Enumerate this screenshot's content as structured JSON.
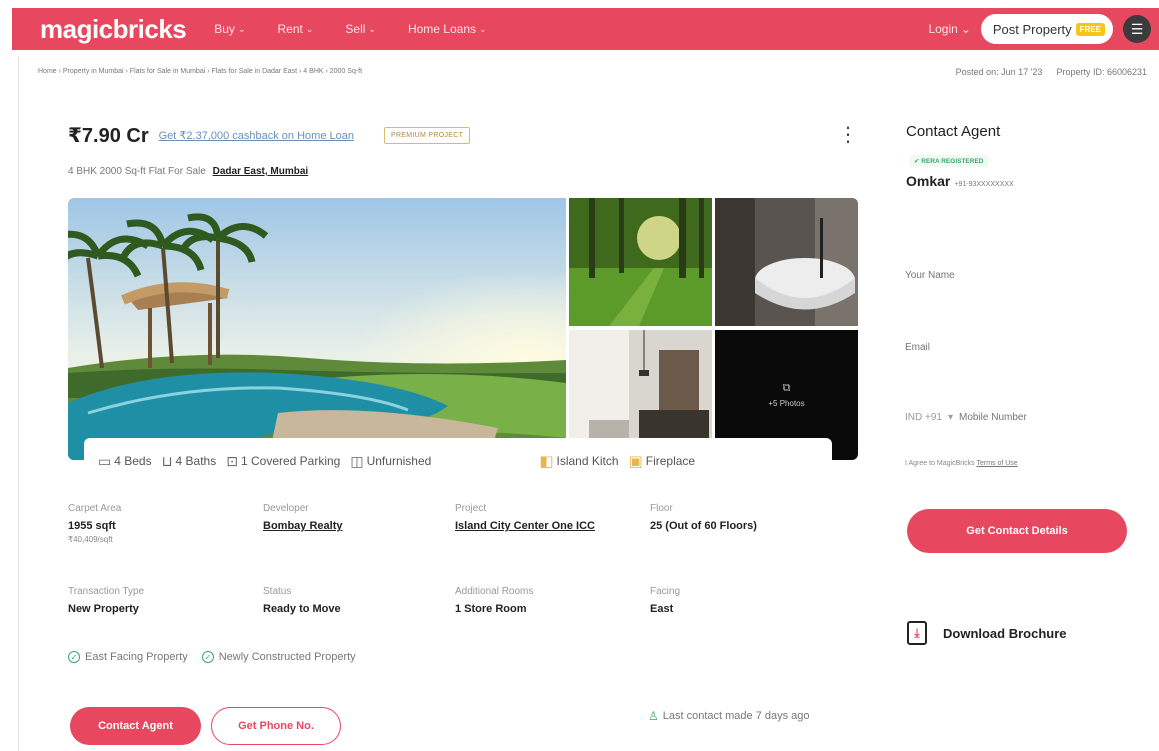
{
  "header": {
    "logo": "magicbricks",
    "nav": [
      "Buy",
      "Rent",
      "Sell",
      "Home Loans"
    ],
    "login": "Login",
    "post_property": "Post Property",
    "free_badge": "FREE"
  },
  "breadcrumb": "Home › Property in Mumbai › Flats for Sale in Mumbai › Flats for Sale in Dadar East › 4 BHK › 2000 Sq-ft",
  "posted": "Posted on: Jun 17 '23",
  "property_id": "Property ID: 66006231",
  "listing": {
    "price": "₹7.90 Cr",
    "cashback": "Get ₹2.37,000 cashback on Home Loan",
    "premium": "PREMIUM PROJECT",
    "subtitle": "4 BHK 2000 Sq-ft Flat For Sale",
    "location": "Dadar East, Mumbai",
    "more_photos": "+5 Photos"
  },
  "amenities": {
    "beds": "4 Beds",
    "baths": "4 Baths",
    "parking": "1 Covered Parking",
    "furnishing": "Unfurnished",
    "extra1": "Island Kitch",
    "extra2": "Fireplace"
  },
  "details": [
    {
      "label": "Carpet Area",
      "value": "1955 sqft",
      "sub": "₹40,409/sqft"
    },
    {
      "label": "Developer",
      "value": "Bombay Realty"
    },
    {
      "label": "Project",
      "value": "Island City Center One ICC"
    },
    {
      "label": "Floor",
      "value": "25 (Out of 60 Floors)"
    },
    {
      "label": "Transaction Type",
      "value": "New Property"
    },
    {
      "label": "Status",
      "value": "Ready to Move"
    },
    {
      "label": "Additional Rooms",
      "value": "1 Store Room"
    },
    {
      "label": "Facing",
      "value": "East"
    }
  ],
  "tags": [
    "East Facing Property",
    "Newly Constructed Property"
  ],
  "buttons": {
    "contact_agent": "Contact Agent",
    "get_phone": "Get Phone No."
  },
  "last_contact": "Last contact made 7 days ago",
  "contact_panel": {
    "title": "Contact Agent",
    "rera": "✔ RERA REGISTERED",
    "agent_name": "Omkar",
    "agent_phone": "+91-93XXXXXXXX",
    "name_placeholder": "Your Name",
    "email_placeholder": "Email",
    "country_code": "IND +91",
    "mobile_placeholder": "Mobile Number",
    "agree_text": "I Agree to MagicBricks",
    "terms": "Terms of Use",
    "get_details": "Get Contact Details",
    "brochure": "Download Brochure"
  },
  "colors": {
    "brand": "#e8485f",
    "success": "#3aa86b"
  }
}
